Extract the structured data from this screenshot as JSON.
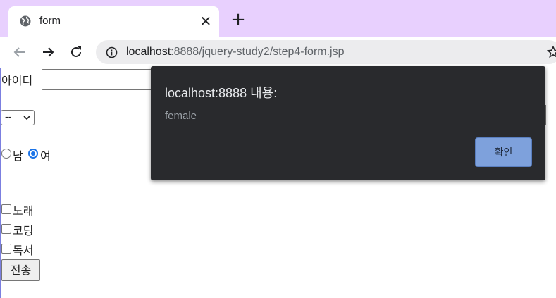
{
  "browser": {
    "tab_title": "form",
    "tab_close": "✕",
    "new_tab": "+",
    "url_host": "localhost",
    "url_path": ":8888/jquery-study2/step4-form.jsp",
    "accent_color": "#e8d0fe"
  },
  "form": {
    "id_label": "아이디",
    "id_value": "",
    "select_value": "--",
    "gender_options": [
      {
        "label": "남",
        "checked": false
      },
      {
        "label": "여",
        "checked": true
      }
    ],
    "hobbies": [
      {
        "label": "노래",
        "checked": false
      },
      {
        "label": "코딩",
        "checked": false
      },
      {
        "label": "독서",
        "checked": false
      }
    ],
    "submit_label": "전송"
  },
  "dialog": {
    "title": "localhost:8888 내용:",
    "message": "female",
    "ok_label": "확인",
    "ok_color": "#7ea1dc"
  }
}
